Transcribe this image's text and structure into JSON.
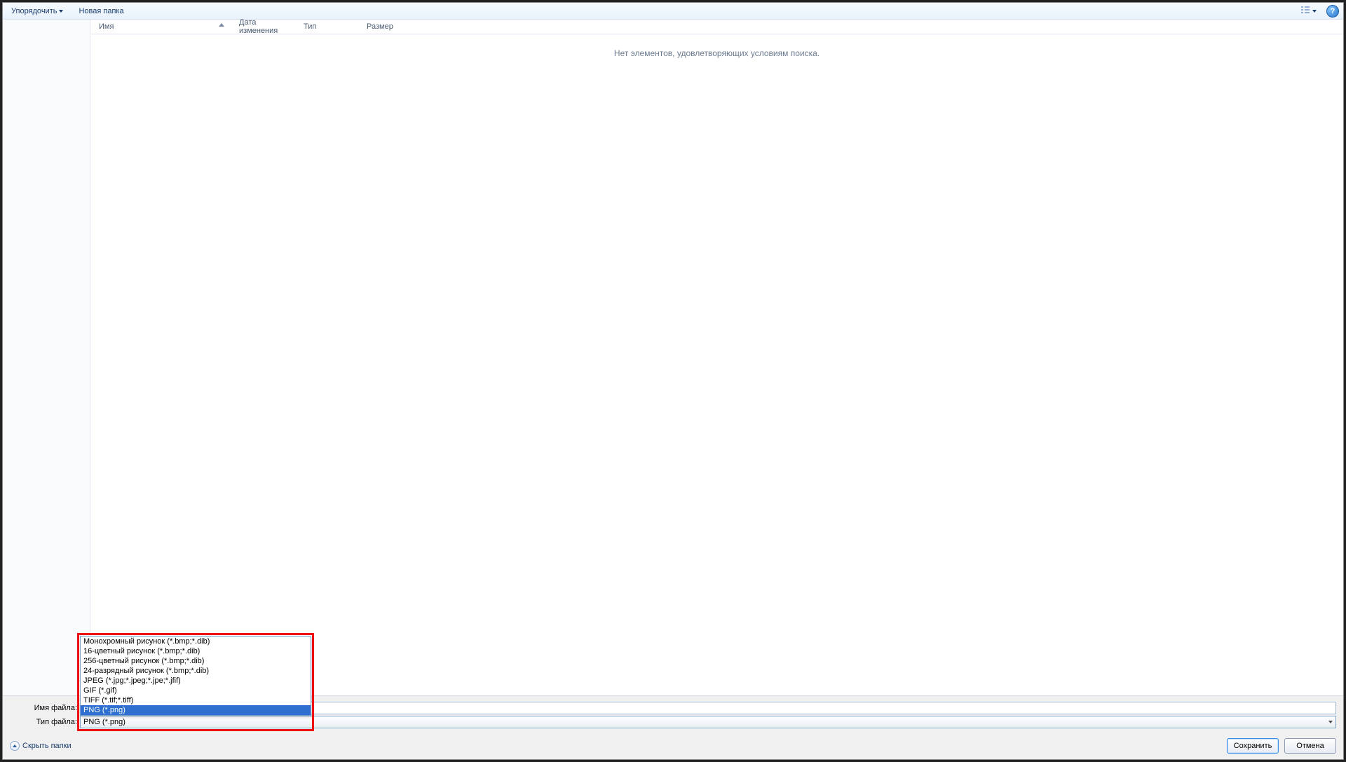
{
  "toolbar": {
    "organize_label": "Упорядочить",
    "new_folder_label": "Новая папка"
  },
  "columns": {
    "name": "Имя",
    "date": "Дата изменения",
    "type": "Тип",
    "size": "Размер"
  },
  "empty_message": "Нет элементов, удовлетворяющих условиям поиска.",
  "filename_label": "Имя файла:",
  "filetype_label": "Тип файла:",
  "filename_value": "",
  "filetype_selected": "PNG (*.png)",
  "filetype_options": [
    "Монохромный рисунок (*.bmp;*.dib)",
    "16-цветный рисунок (*.bmp;*.dib)",
    "256-цветный рисунок (*.bmp;*.dib)",
    "24-разрядный рисунок (*.bmp;*.dib)",
    "JPEG (*.jpg;*.jpeg;*.jpe;*.jfif)",
    "GIF (*.gif)",
    "TIFF (*.tif;*.tiff)",
    "PNG (*.png)"
  ],
  "filetype_selected_index": 7,
  "hide_folders_label": "Скрыть папки",
  "save_label": "Сохранить",
  "cancel_label": "Отмена",
  "help_glyph": "?"
}
